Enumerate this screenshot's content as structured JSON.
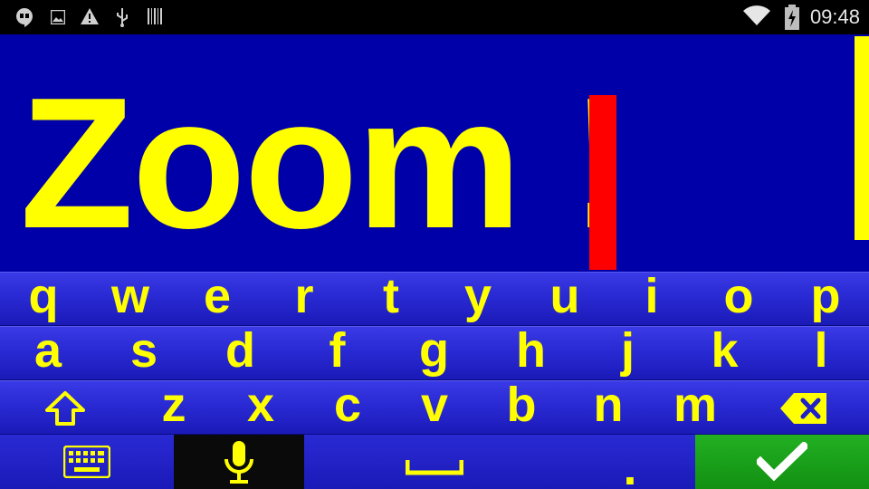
{
  "status_bar": {
    "icons": [
      "hangouts-icon",
      "image-icon",
      "warning-icon",
      "usb-icon",
      "barcode-icon",
      "wifi-icon",
      "battery-charging-icon"
    ],
    "time": "09:48"
  },
  "editor": {
    "text": "Zoom !"
  },
  "keyboard": {
    "row1": [
      "q",
      "w",
      "e",
      "r",
      "t",
      "y",
      "u",
      "i",
      "o",
      "p"
    ],
    "row2": [
      "a",
      "s",
      "d",
      "f",
      "g",
      "h",
      "j",
      "k",
      "l"
    ],
    "row3": [
      "z",
      "x",
      "c",
      "v",
      "b",
      "n",
      "m"
    ],
    "period": ".",
    "colors": {
      "key_text": "#ffff00",
      "key_bg": "#2a2ad4",
      "editor_bg": "#0000a8",
      "cursor": "#ff0000",
      "enter_bg": "#22b022",
      "mic_bg": "#0a0a0a"
    },
    "icons": {
      "shift": "shift-arrow-icon",
      "backspace": "backspace-icon",
      "keyboard_switch": "keyboard-icon",
      "mic": "microphone-icon",
      "space": "space-bar-icon",
      "enter": "checkmark-icon"
    }
  }
}
